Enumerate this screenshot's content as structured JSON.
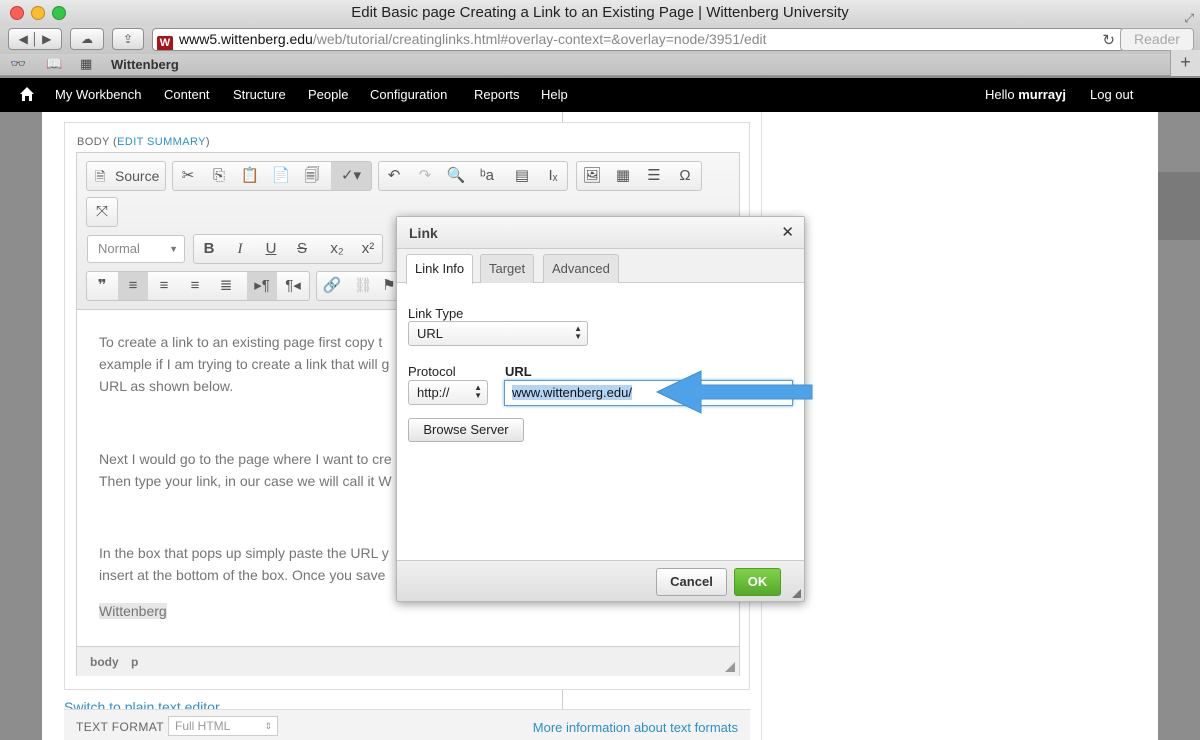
{
  "browser": {
    "title": "Edit Basic page Creating a Link to an Existing Page | Wittenberg University",
    "url_host": "www5.wittenberg.edu",
    "url_path": "/web/tutorial/creatinglinks.html#overlay-context=&overlay=node/3951/edit",
    "reader_label": "Reader",
    "bookmark_label": "Wittenberg"
  },
  "admin_bar": {
    "items": [
      "My Workbench",
      "Content",
      "Structure",
      "People",
      "Configuration",
      "Reports",
      "Help"
    ],
    "hello_prefix": "Hello ",
    "user": "murrayj",
    "logout": "Log out"
  },
  "editor": {
    "body_label": "BODY (",
    "edit_summary": "EDIT SUMMARY",
    "body_label_end": ")",
    "source_label": "Source",
    "format_combo": "Normal",
    "paragraphs": [
      "To create a link to an existing page first copy t",
      "example if I am trying to create a link that will g",
      "URL as shown below.",
      "Next I would go to the page where I want to cre",
      "Then type your link, in our case we will call it W",
      "In the box that pops up simply paste the URL y",
      "insert at the bottom of the box. Once you save",
      "Wittenberg"
    ],
    "path": [
      "body",
      "p"
    ],
    "switch_link": "Switch to plain text editor"
  },
  "text_format": {
    "label": "TEXT FORMAT",
    "value": "Full HTML",
    "more_info": "More information about text formats"
  },
  "dialog": {
    "title": "Link",
    "tabs": [
      "Link Info",
      "Target",
      "Advanced"
    ],
    "link_type_label": "Link Type",
    "link_type_value": "URL",
    "protocol_label": "Protocol",
    "protocol_value": "http://",
    "url_label": "URL",
    "url_value": "www.wittenberg.edu/",
    "browse_server": "Browse Server",
    "cancel": "Cancel",
    "ok": "OK"
  },
  "colors": {
    "accent_link": "#2c8fc8",
    "ok_green": "#55a82a",
    "arrow_blue": "#4ea3e8",
    "admin_bar": "#000000"
  }
}
